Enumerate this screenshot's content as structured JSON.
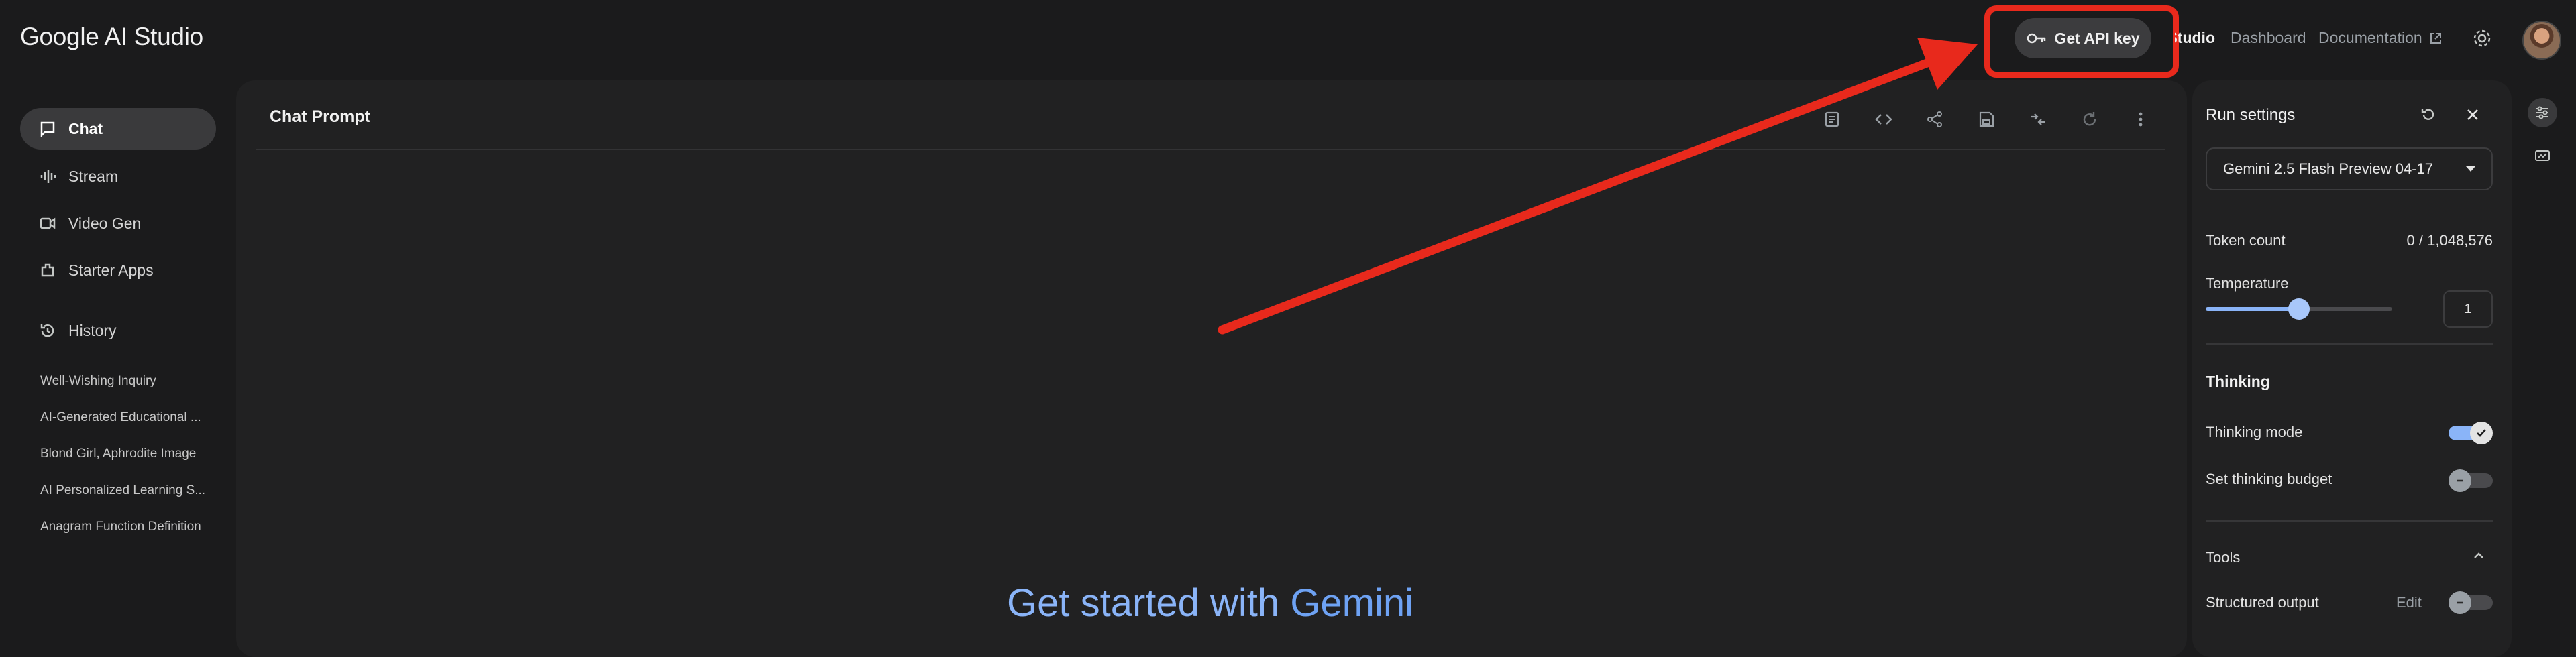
{
  "header": {
    "app_title": "Google AI Studio",
    "api_key_button": "Get API key",
    "nav": {
      "studio": "Studio",
      "dashboard": "Dashboard",
      "documentation": "Documentation"
    }
  },
  "sidebar": {
    "items": [
      {
        "label": "Chat",
        "icon": "chat-icon",
        "active": true
      },
      {
        "label": "Stream",
        "icon": "stream-icon"
      },
      {
        "label": "Video Gen",
        "icon": "video-icon"
      },
      {
        "label": "Starter Apps",
        "icon": "apps-icon"
      }
    ],
    "history": {
      "label": "History",
      "items": [
        "Well-Wishing Inquiry",
        "AI-Generated Educational ...",
        "Blond Girl, Aphrodite Image",
        "AI Personalized Learning S...",
        "Anagram Function Definition"
      ]
    }
  },
  "main": {
    "title": "Chat Prompt",
    "toolbar_icons": [
      "notes-icon",
      "code-icon",
      "share-icon",
      "save-icon",
      "compare-icon",
      "refresh-icon",
      "more-icon"
    ],
    "get_started_prefix": "Get started with",
    "get_started_brand": "Gemini"
  },
  "run_settings": {
    "title": "Run settings",
    "model": "Gemini 2.5 Flash Preview 04-17",
    "token_count_label": "Token count",
    "token_count_value": "0 / 1,048,576",
    "temperature_label": "Temperature",
    "temperature_value": "1",
    "temperature_fraction": 0.5,
    "thinking_heading": "Thinking",
    "thinking_mode_label": "Thinking mode",
    "thinking_mode_on": true,
    "thinking_budget_label": "Set thinking budget",
    "thinking_budget_on": false,
    "tools_heading": "Tools",
    "structured_output_label": "Structured output",
    "structured_output_edit": "Edit",
    "structured_output_on": false
  },
  "annotation": {
    "color": "#e8291c"
  },
  "colors": {
    "accent": "#8ab4f8",
    "background": "#1b1b1c",
    "panel": "#212122"
  }
}
